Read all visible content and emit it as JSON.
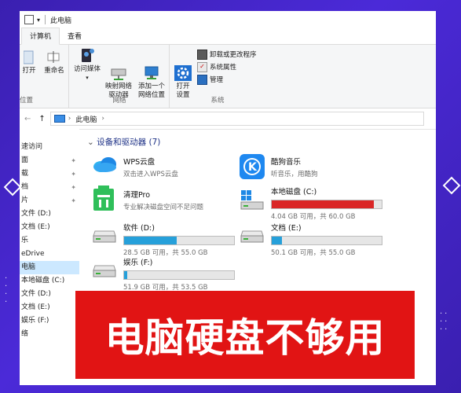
{
  "window": {
    "title": "此电脑",
    "tabs": [
      "计算机",
      "查看"
    ],
    "active_tab": 0
  },
  "ribbon": {
    "left_partial": {
      "open": "打开",
      "rename": "重命名",
      "location_group": "位置"
    },
    "network": {
      "label": "网络",
      "access_media": "访问媒体",
      "map_drive": "映射网络\n驱动器",
      "add_location": "添加一个\n网络位置"
    },
    "system": {
      "label": "系统",
      "open_settings": "打开\n设置",
      "uninstall": "卸载或更改程序",
      "properties": "系统属性",
      "manage": "管理"
    }
  },
  "address": {
    "path": "此电脑"
  },
  "nav": {
    "items": [
      {
        "label": "速访问",
        "pinned": false
      },
      {
        "label": "面",
        "pinned": true
      },
      {
        "label": "载",
        "pinned": true
      },
      {
        "label": "档",
        "pinned": true
      },
      {
        "label": "片",
        "pinned": true
      },
      {
        "label": "文件 (D:)",
        "pinned": false
      },
      {
        "label": "文档 (E:)",
        "pinned": false
      },
      {
        "label": "乐",
        "pinned": false
      },
      {
        "label": "eDrive",
        "pinned": false
      },
      {
        "label": "电脑",
        "pinned": false,
        "selected": true
      },
      {
        "label": "本地磁盘 (C:)",
        "pinned": false
      },
      {
        "label": "文件 (D:)",
        "pinned": false
      },
      {
        "label": "文档 (E:)",
        "pinned": false
      },
      {
        "label": "娱乐 (F:)",
        "pinned": false
      },
      {
        "label": "络",
        "pinned": false
      }
    ]
  },
  "content": {
    "section_title": "设备和驱动器 (7)",
    "apps": [
      {
        "name": "WPS云盘",
        "sub": "双击进入WPS云盘",
        "icon": "wps-cloud-icon"
      },
      {
        "name": "酷狗音乐",
        "sub": "听音乐，用酷狗",
        "icon": "kugou-icon"
      },
      {
        "name": "清理Pro",
        "sub": "专业解决磁盘空间不足问题",
        "icon": "cleaner-icon"
      }
    ],
    "drives": [
      {
        "name": "本地磁盘 (C:)",
        "sub": "4.04 GB 可用，共 60.0 GB",
        "used_fraction": 0.93,
        "critical": true,
        "icon": "windows-drive-icon"
      },
      {
        "name": "软件 (D:)",
        "sub": "28.5 GB 可用，共 55.0 GB",
        "used_fraction": 0.48,
        "critical": false,
        "icon": "drive-icon"
      },
      {
        "name": "文档 (E:)",
        "sub": "50.1 GB 可用，共 55.0 GB",
        "used_fraction": 0.09,
        "critical": false,
        "icon": "drive-icon"
      },
      {
        "name": "娱乐 (F:)",
        "sub": "51.9 GB 可用，共 53.5 GB",
        "used_fraction": 0.03,
        "critical": false,
        "icon": "drive-icon"
      }
    ]
  },
  "banner": {
    "text": "电脑硬盘不够用"
  },
  "colors": {
    "accent": "#26a0da",
    "critical": "#da2626",
    "banner": "#e11414",
    "background": "#3f22c8"
  }
}
